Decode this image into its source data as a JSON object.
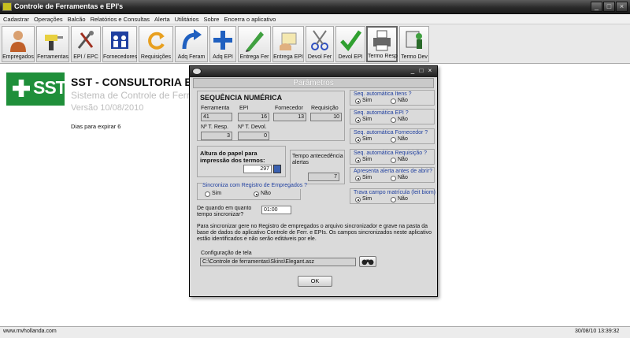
{
  "window": {
    "title": "Controle de Ferramentas e EPI's"
  },
  "menu": [
    "Cadastrar",
    "Operações",
    "Balcão",
    "Relatórios e Consultas",
    "Alerta",
    "Utilitários",
    "Sobre",
    "Encerra o aplicativo"
  ],
  "toolbar": [
    {
      "label": "Empregados",
      "icon": "employee-icon"
    },
    {
      "label": "Ferramentas",
      "icon": "drill-icon"
    },
    {
      "label": "EPI / EPC",
      "icon": "tools-icon"
    },
    {
      "label": "Fornecedores",
      "icon": "suppliers-icon"
    },
    {
      "label": "Requisições",
      "icon": "refresh-icon"
    },
    {
      "label": "Adq Feram",
      "icon": "arrow-icon"
    },
    {
      "label": "Adq EPI",
      "icon": "plus-icon"
    },
    {
      "label": "Entrega Fer",
      "icon": "pen-icon"
    },
    {
      "label": "Entrega EPI",
      "icon": "hand-icon"
    },
    {
      "label": "Devol Fer",
      "icon": "scissors-icon"
    },
    {
      "label": "Devol EPI",
      "icon": "check-icon"
    },
    {
      "label": "Termo Resp",
      "icon": "printer-icon"
    },
    {
      "label": "Termo Dev",
      "icon": "man-icon"
    }
  ],
  "company": {
    "logo_text": "SST",
    "name": "SST - CONSULTORIA EM",
    "system": "Sistema de Controle de Ferramen",
    "version": "Versão 10/08/2010",
    "expire": "Dias para expirar 6"
  },
  "status": {
    "left": "www.mvhollanda.com",
    "right": "30/08/10 13:39:32"
  },
  "dialog": {
    "title": "Parâmetros",
    "seq_heading": "SEQUÊNCIA NUMÉRICA",
    "seq_fields": [
      {
        "label": "Ferramenta",
        "value": "41"
      },
      {
        "label": "EPI",
        "value": "16"
      },
      {
        "label": "Fornecedor",
        "value": "13"
      },
      {
        "label": "Requisição",
        "value": "10"
      },
      {
        "label": "Nº T. Resp.",
        "value": "3"
      },
      {
        "label": "Nº T. Devol.",
        "value": "0"
      }
    ],
    "paper_label": "Altura do papel para impressão dos termos:",
    "paper_value": "297",
    "alert_label": "Tempo antecedência alertas",
    "alert_value": "7",
    "sync_label": "Sincroniza com Registro de Empregados ?",
    "sync_since_label": "De quando em quanto tempo sincronizar?",
    "sync_time": "01:00",
    "info_text": "Para sincronizar gere no Registro de empregados o arquivo sincronizador e grave na pasta da base de dados do aplicativo Controle de Ferr. e EPIs. Os campos sincronizados neste aplicativo estão identificados e não serão editáveis por ele.",
    "skin_label": "Configuração de tela",
    "skin_path": "C:\\Controle de ferramentas\\Skins\\Elegant.asz",
    "ok_label": "OK",
    "yes": "Sim",
    "no": "Não",
    "options": [
      {
        "label": "Seq. automática Itens ?",
        "selected": "Sim"
      },
      {
        "label": "Seq. automática EPI ?",
        "selected": "Sim"
      },
      {
        "label": "Seq. automática Fornecedor ?",
        "selected": "Sim"
      },
      {
        "label": "Seq. automática Requisição ?",
        "selected": "Sim"
      },
      {
        "label": "Apresenta alerta antes de abrir?",
        "selected": "Sim"
      },
      {
        "label": "Trava campo matrícula (leit biom)",
        "selected": "Sim"
      }
    ],
    "sync_selected": "Não"
  }
}
